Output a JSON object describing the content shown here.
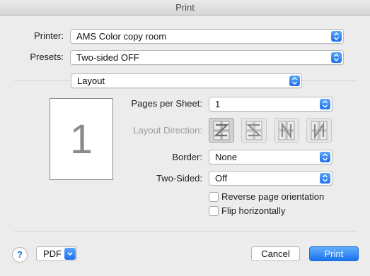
{
  "window": {
    "title": "Print"
  },
  "printer": {
    "label": "Printer:",
    "value": "AMS Color copy room"
  },
  "presets": {
    "label": "Presets:",
    "value": "Two-sided OFF"
  },
  "section": {
    "value": "Layout"
  },
  "preview": {
    "page_number": "1"
  },
  "pages_per_sheet": {
    "label": "Pages per Sheet:",
    "value": "1"
  },
  "layout_direction": {
    "label": "Layout Direction:",
    "options": [
      "z-order-icon",
      "reverse-z-order-icon",
      "n-order-icon",
      "reverse-n-order-icon"
    ],
    "selected": 0
  },
  "border": {
    "label": "Border:",
    "value": "None"
  },
  "two_sided": {
    "label": "Two-Sided:",
    "value": "Off"
  },
  "reverse_orientation": {
    "label": "Reverse page orientation",
    "checked": false
  },
  "flip_horizontally": {
    "label": "Flip horizontally",
    "checked": false
  },
  "footer": {
    "help": "?",
    "pdf": "PDF",
    "cancel": "Cancel",
    "print": "Print"
  },
  "colors": {
    "accent": "#1d71f0",
    "disabled_text": "#9c9c9c"
  }
}
